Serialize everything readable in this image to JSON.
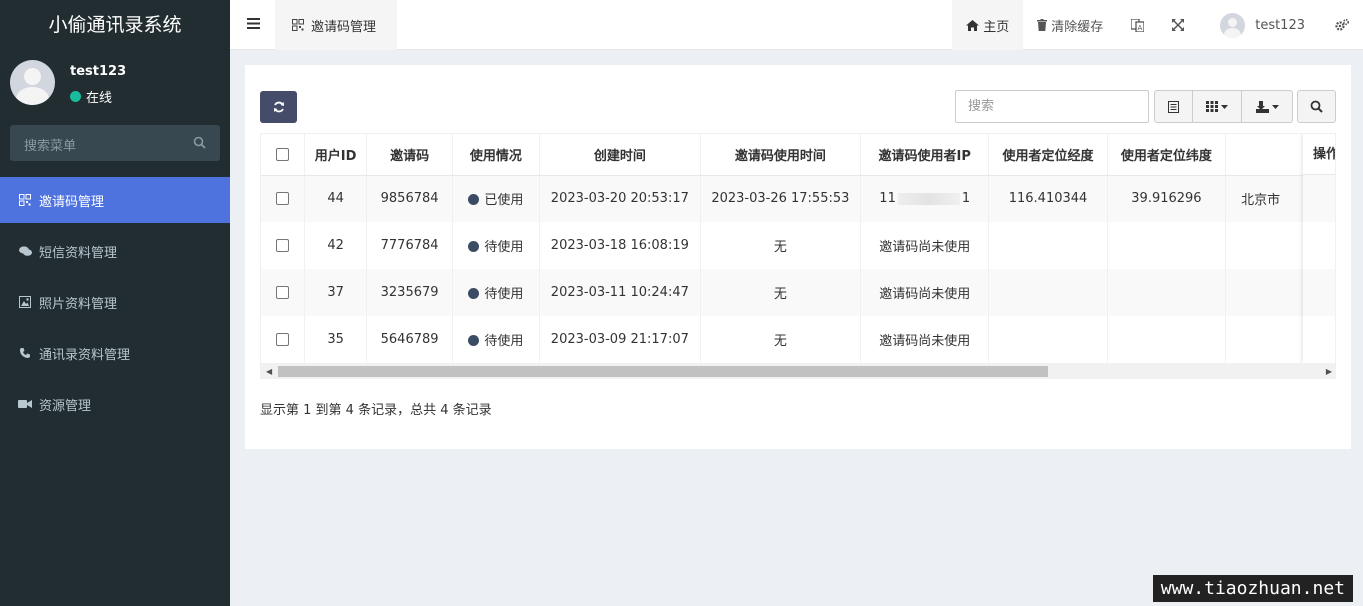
{
  "app": {
    "title": "小偷通讯录系统"
  },
  "user": {
    "name": "test123",
    "status": "在线"
  },
  "sidebar": {
    "search_placeholder": "搜索菜单",
    "items": [
      {
        "label": "邀请码管理",
        "icon": "qrcode-icon",
        "active": true
      },
      {
        "label": "短信资料管理",
        "icon": "comments-icon"
      },
      {
        "label": "照片资料管理",
        "icon": "image-icon"
      },
      {
        "label": "通讯录资料管理",
        "icon": "phone-icon"
      },
      {
        "label": "资源管理",
        "icon": "video-camera-icon"
      }
    ]
  },
  "header": {
    "tab_label": "邀请码管理",
    "home_label": "主页",
    "clear_cache_label": "清除缓存",
    "username": "test123"
  },
  "toolbar": {
    "search_placeholder": "搜索"
  },
  "table": {
    "columns": [
      "用户ID",
      "邀请码",
      "使用情况",
      "创建时间",
      "邀请码使用时间",
      "邀请码使用者IP",
      "使用者定位经度",
      "使用者定位纬度",
      "",
      "操作"
    ],
    "rows": [
      {
        "id": "44",
        "code": "9856784",
        "status": "已使用",
        "created": "2023-03-20 20:53:17",
        "used_at": "2023-03-26 17:55:53",
        "ip_start": "11",
        "ip_end": "1",
        "lng": "116.410344",
        "lat": "39.916296",
        "city": "北京市"
      },
      {
        "id": "42",
        "code": "7776784",
        "status": "待使用",
        "created": "2023-03-18 16:08:19",
        "used_at": "无",
        "ip": "邀请码尚未使用",
        "lng": "",
        "lat": "",
        "city": ""
      },
      {
        "id": "37",
        "code": "3235679",
        "status": "待使用",
        "created": "2023-03-11 10:24:47",
        "used_at": "无",
        "ip": "邀请码尚未使用",
        "lng": "",
        "lat": "",
        "city": ""
      },
      {
        "id": "35",
        "code": "5646789",
        "status": "待使用",
        "created": "2023-03-09 21:17:07",
        "used_at": "无",
        "ip": "邀请码尚未使用",
        "lng": "",
        "lat": "",
        "city": ""
      }
    ]
  },
  "pagination": {
    "summary": "显示第 1 到第 4 条记录，总共 4 条记录"
  },
  "watermark": "www.tiaozhuan.net",
  "colors": {
    "sidebar_bg": "#222d32",
    "active_menu": "#4e73df",
    "status_online": "#18bc9c",
    "dot": "#3c4b64"
  }
}
